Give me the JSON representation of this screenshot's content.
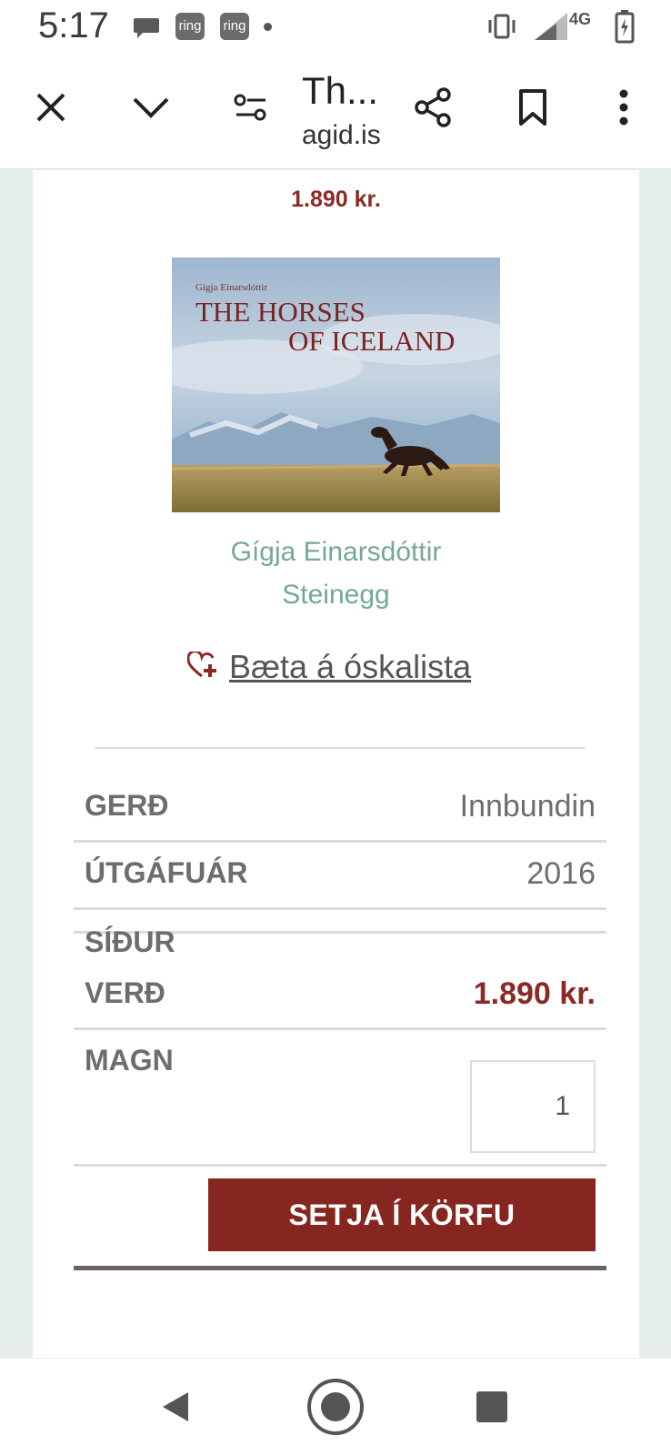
{
  "status_bar": {
    "time": "5:17",
    "notification_badges": [
      "ring",
      "ring"
    ],
    "network": "4G"
  },
  "toolbar": {
    "title": "Th...",
    "url": "agid.is"
  },
  "product": {
    "price_top": "1.890 kr.",
    "cover": {
      "author": "Gígja Einarsdóttir",
      "title_line1": "THE HORSES",
      "title_line2": "OF ICELAND"
    },
    "authors": [
      "Gígja Einarsdóttir",
      "Steinegg"
    ],
    "wishlist_label": "Bæta á óskalista",
    "details": [
      {
        "label": "GERÐ",
        "value": "Innbundin"
      },
      {
        "label": "ÚTGÁFUÁR",
        "value": "2016"
      },
      {
        "label": "SÍÐUR",
        "value": ""
      },
      {
        "label": "VERÐ",
        "value": "1.890 kr."
      }
    ],
    "quantity_label": "MAGN",
    "quantity_value": "1",
    "add_to_cart": "SETJA Í KÖRFU"
  },
  "colors": {
    "accent": "#862620",
    "author_link": "#74a994",
    "background": "#e6eeea"
  }
}
